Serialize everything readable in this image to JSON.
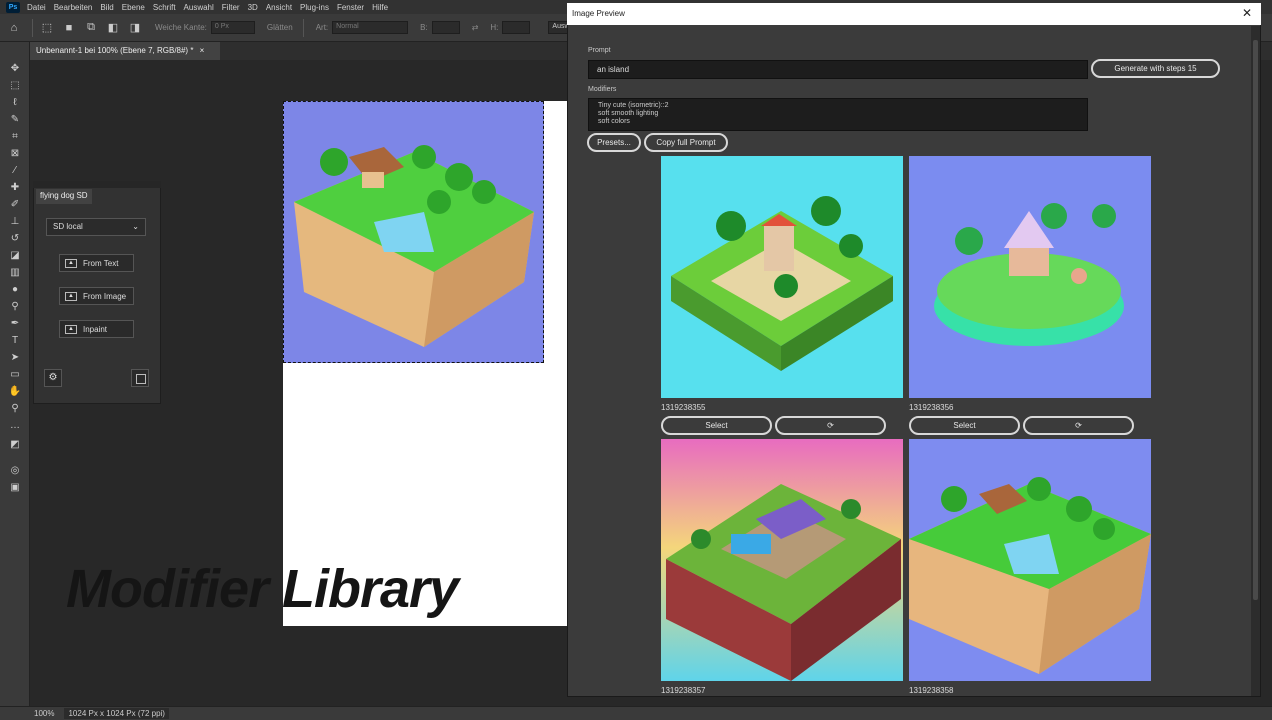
{
  "app": {
    "logo": "Ps",
    "menu": [
      "Datei",
      "Bearbeiten",
      "Bild",
      "Ebene",
      "Schrift",
      "Auswahl",
      "Filter",
      "3D",
      "Ansicht",
      "Plug-ins",
      "Fenster",
      "Hilfe"
    ]
  },
  "options_bar": {
    "soft_edge_label": "Weiche Kante:",
    "soft_edge_value": "0 Px",
    "smooth_label": "Glätten",
    "style_label": "Art:",
    "style_value": "Normal",
    "width_label": "B:",
    "height_label": "H:",
    "select_button": "Auswä"
  },
  "document": {
    "tab_title": "Unbenannt-1 bei 100% (Ebene 7, RGB/8#) *"
  },
  "overlay_text": "Modifier Library",
  "flying_dog_panel": {
    "tab": "flying dog SD",
    "mode_select": "SD local",
    "buttons": [
      "From Text",
      "From Image",
      "Inpaint"
    ]
  },
  "status_bar": {
    "zoom": "100%",
    "doc_info": "1024 Px x 1024 Px (72 ppi)"
  },
  "image_preview": {
    "window_title": "Image Preview",
    "prompt_label": "Prompt",
    "prompt_value": "an island",
    "generate_button": "Generate with steps 15",
    "modifiers_label": "Modifiers",
    "modifiers_value": "Tiny cute (isometric)::2\nsoft smooth lighting\nsoft colors",
    "presets_button": "Presets...",
    "copy_button": "Copy full Prompt",
    "select_label": "Select",
    "images": [
      {
        "seed": "1319238355",
        "bg": "#57e0ee"
      },
      {
        "seed": "1319238356",
        "bg": "#7b8cf0"
      },
      {
        "seed": "1319238357",
        "bg": "#e86cc0"
      },
      {
        "seed": "1319238358",
        "bg": "#7e8cf0"
      }
    ]
  },
  "colors": {
    "ps_dark": "#282828",
    "panel": "#3b3b3b",
    "accent_blue": "#31a8ff"
  }
}
